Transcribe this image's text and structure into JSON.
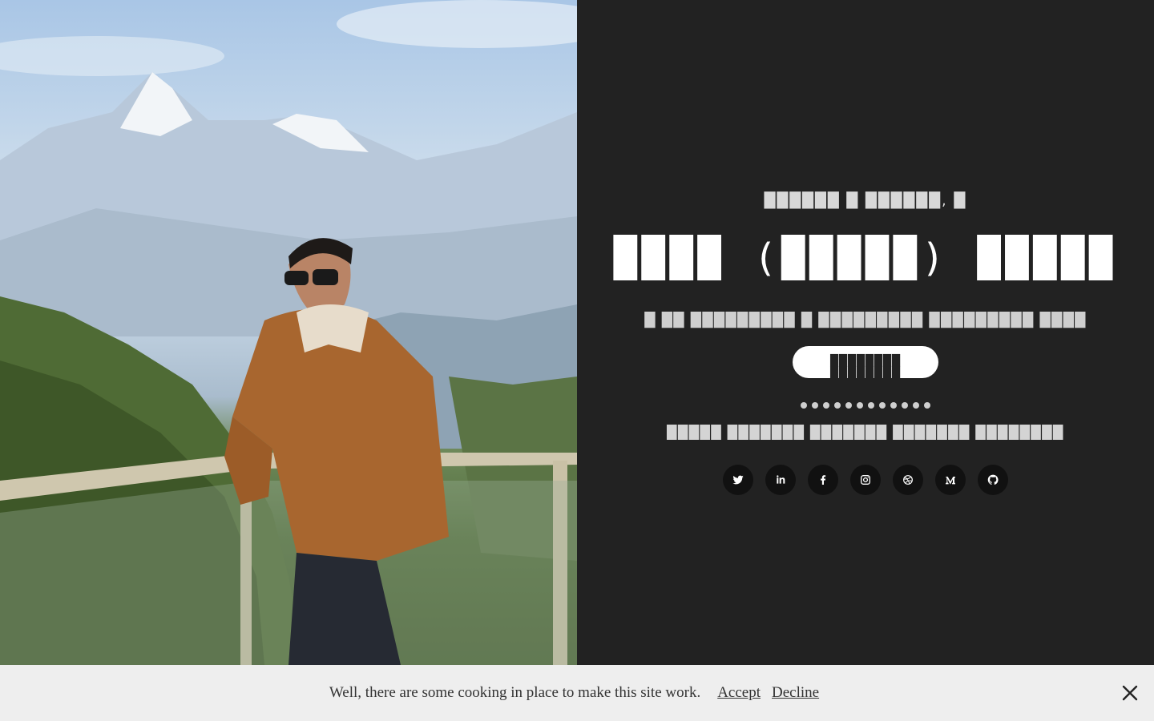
{
  "hero": {
    "greeting": "██████ █ ██████, █",
    "name": "████ (█████) █████",
    "tagline": "█ ██ █████████ █ █████████ █████████ ████",
    "cta_label": "████████ ████████",
    "skills": "█████ ███████ ███████ ███████ ████████"
  },
  "socials": [
    {
      "icon": "twitter-icon"
    },
    {
      "icon": "linkedin-icon"
    },
    {
      "icon": "facebook-icon"
    },
    {
      "icon": "instagram-icon"
    },
    {
      "icon": "dribbble-icon"
    },
    {
      "icon": "medium-icon"
    },
    {
      "icon": "github-icon"
    }
  ],
  "cookie_banner": {
    "text": "Well, there are some cooking in place to make this site work.",
    "accept_label": "Accept",
    "decline_label": "Decline"
  },
  "colors": {
    "background": "#222222",
    "button_bg": "#ffffff",
    "social_bg": "#111111",
    "cookie_bg": "#eeeeee"
  }
}
